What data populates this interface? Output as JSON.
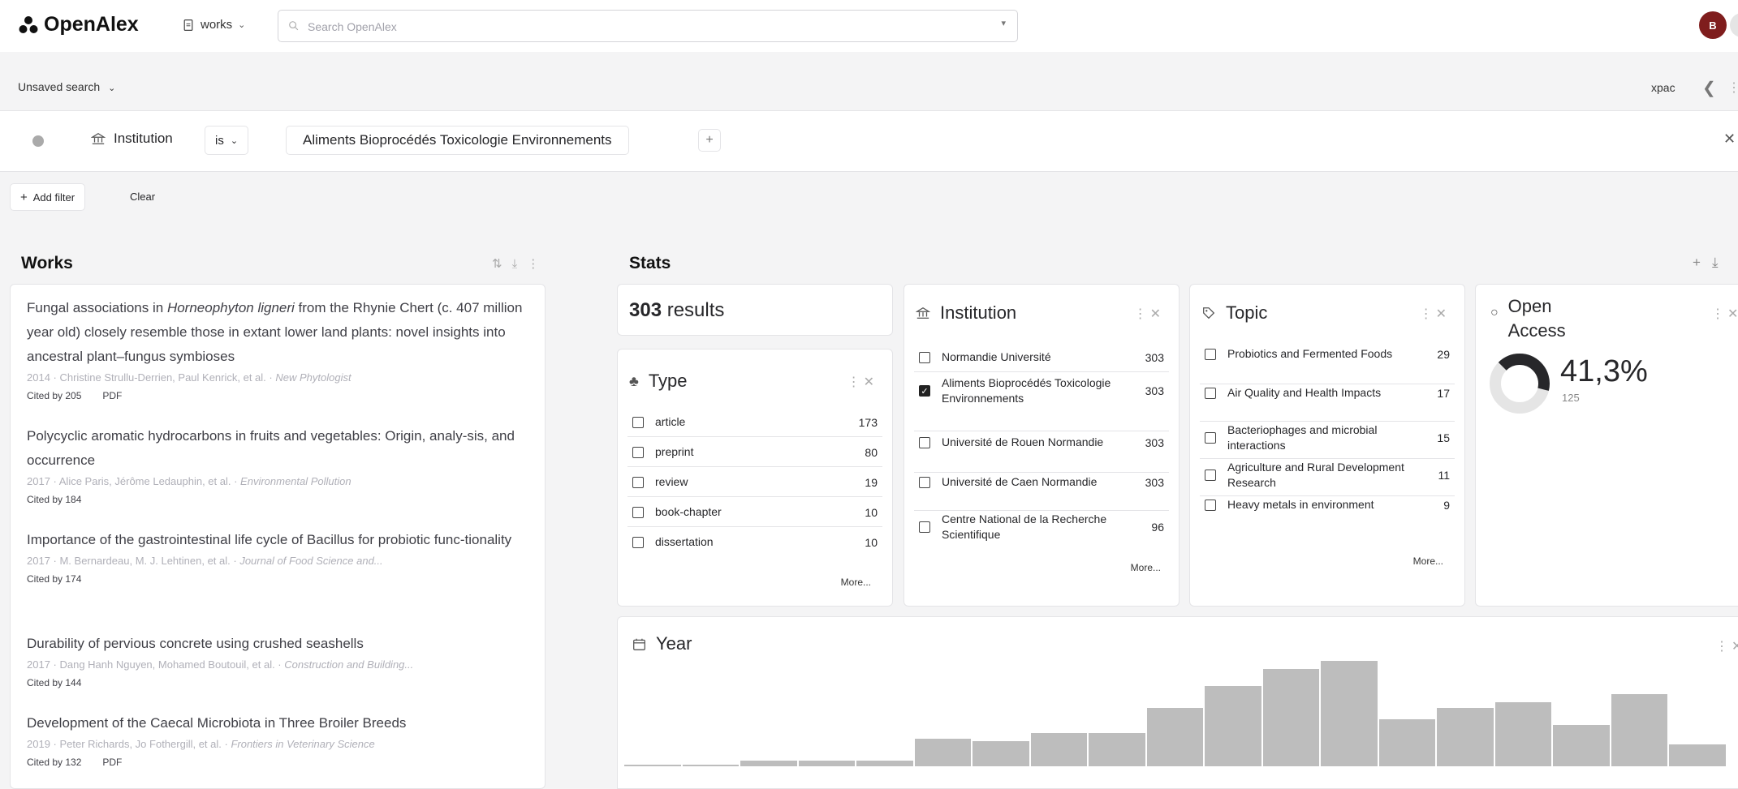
{
  "app": {
    "name": "OpenAlex",
    "entity_label": "works",
    "search_placeholder": "Search OpenAlex",
    "avatar_initial": "B"
  },
  "searchbar": {
    "title": "Unsaved search",
    "right_label": "xpac"
  },
  "filter": {
    "field": "Institution",
    "operator": "is",
    "value": "Aliments Bioprocédés Toxicologie Environnements",
    "add_filter_label": "Add filter",
    "clear_label": "Clear"
  },
  "works": {
    "heading": "Works",
    "items": [
      {
        "title_pre": "Fungal associations in ",
        "title_em": "Horneophyton ligneri",
        "title_post": " from the Rhynie Chert (c. 407 million year old) closely resemble those in extant lower land plants: novel insights into ancestral plant–fungus symbioses",
        "meta": "2014 · Christine Strullu-Derrien, Paul Kenrick, et al. · ",
        "venue": "New Phytologist",
        "cited": "Cited by 205",
        "pdf": "PDF"
      },
      {
        "title_pre": "Polycyclic aromatic hydrocarbons in fruits and vegetables: Origin, analy-sis, and occurrence",
        "title_em": "",
        "title_post": "",
        "meta": "2017 · Alice Paris, Jérôme Ledauphin, et al. · ",
        "venue": "Environmental Pollution",
        "cited": "Cited by 184",
        "pdf": ""
      },
      {
        "title_pre": "Importance of the gastrointestinal life cycle of Bacillus for probiotic func-tionality",
        "title_em": "",
        "title_post": "",
        "meta": "2017 · M. Bernardeau, M. J. Lehtinen, et al. · ",
        "venue": "Journal of Food Science and...",
        "cited": "Cited by 174",
        "pdf": ""
      },
      {
        "title_pre": "Durability of pervious concrete using crushed seashells",
        "title_em": "",
        "title_post": "",
        "meta": "2017 · Dang Hanh Nguyen, Mohamed Boutouil, et al. · ",
        "venue": "Construction and Building...",
        "cited": "Cited by 144",
        "pdf": ""
      },
      {
        "title_pre": "Development of the Caecal Microbiota in Three Broiler Breeds",
        "title_em": "",
        "title_post": "",
        "meta": "2019 · Peter Richards, Jo Fothergill, et al. · ",
        "venue": "Frontiers in Veterinary Science",
        "cited": "Cited by 132",
        "pdf": "PDF"
      }
    ]
  },
  "stats": {
    "heading": "Stats",
    "results_count": "303",
    "results_label": "results",
    "type": {
      "title": "Type",
      "rows": [
        {
          "label": "article",
          "count": "173",
          "checked": false
        },
        {
          "label": "preprint",
          "count": "80",
          "checked": false
        },
        {
          "label": "review",
          "count": "19",
          "checked": false
        },
        {
          "label": "book-chapter",
          "count": "10",
          "checked": false
        },
        {
          "label": "dissertation",
          "count": "10",
          "checked": false
        }
      ],
      "more": "More..."
    },
    "institution": {
      "title": "Institution",
      "rows": [
        {
          "label": "Normandie Université",
          "count": "303",
          "checked": false
        },
        {
          "label": "Aliments Bioprocédés Toxicologie Environnements",
          "count": "303",
          "checked": true
        },
        {
          "label": "Université de Rouen Normandie",
          "count": "303",
          "checked": false
        },
        {
          "label": "Université de Caen Normandie",
          "count": "303",
          "checked": false
        },
        {
          "label": "Centre National de la Recherche Scientifique",
          "count": "96",
          "checked": false
        }
      ],
      "more": "More..."
    },
    "topic": {
      "title": "Topic",
      "rows": [
        {
          "label": "Probiotics and Fermented Foods",
          "count": "29",
          "checked": false
        },
        {
          "label": "Air Quality and Health Impacts",
          "count": "17",
          "checked": false
        },
        {
          "label": "Bacteriophages and microbial interactions",
          "count": "15",
          "checked": false
        },
        {
          "label": "Agriculture and Rural Development Research",
          "count": "11",
          "checked": false
        },
        {
          "label": "Heavy metals in environment",
          "count": "9",
          "checked": false
        }
      ],
      "more": "More..."
    },
    "open_access": {
      "title": "Open Access",
      "percent_text": "41,3%",
      "count": "125",
      "fraction": 0.413
    },
    "year": {
      "title": "Year"
    }
  },
  "chart_data": {
    "type": "bar",
    "title": "Year",
    "categories": [],
    "values": [
      0.5,
      0.5,
      2,
      2,
      2,
      10,
      9,
      12,
      12,
      21,
      29,
      35,
      38,
      17,
      21,
      23,
      15,
      26,
      8
    ]
  },
  "colors": {
    "accent": "#27272a",
    "bar": "#bdbdbd",
    "avatar": "#7f1d1d"
  }
}
